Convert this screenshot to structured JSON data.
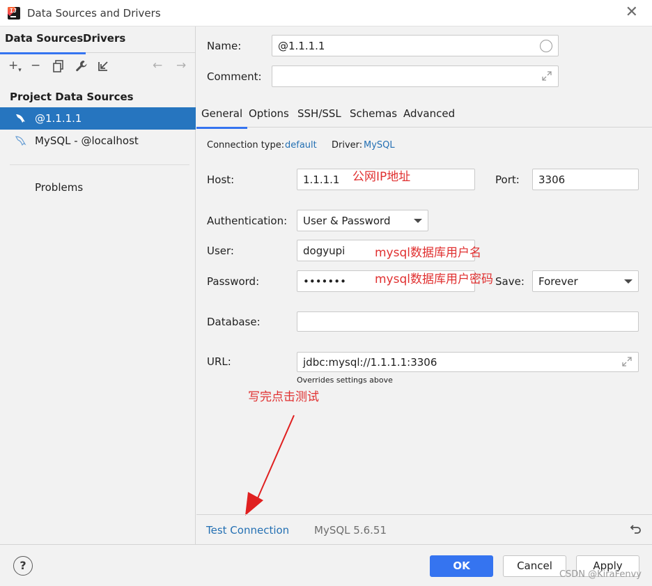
{
  "window": {
    "title": "Data Sources and Drivers"
  },
  "left_panel": {
    "tabs": [
      "Data Sources",
      "Drivers"
    ],
    "section_title": "Project Data Sources",
    "items": [
      {
        "label": "@1.1.1.1",
        "selected": true
      },
      {
        "label": "MySQL - @localhost",
        "selected": false
      }
    ],
    "problems_label": "Problems"
  },
  "form": {
    "name_label": "Name:",
    "name_value": "@1.1.1.1",
    "comment_label": "Comment:",
    "comment_value": "",
    "tabs": [
      "General",
      "Options",
      "SSH/SSL",
      "Schemas",
      "Advanced"
    ],
    "active_tab": "General",
    "connection_type_label": "Connection type:",
    "connection_type_value": "default",
    "driver_label": "Driver:",
    "driver_value": "MySQL",
    "host_label": "Host:",
    "host_value": "1.1.1.1",
    "port_label": "Port:",
    "port_value": "3306",
    "auth_label": "Authentication:",
    "auth_value": "User & Password",
    "user_label": "User:",
    "user_value": "dogyupi",
    "password_label": "Password:",
    "password_value": "•••••••",
    "save_label": "Save:",
    "save_value": "Forever",
    "database_label": "Database:",
    "database_value": "",
    "url_label": "URL:",
    "url_value": "jdbc:mysql://1.1.1.1:3306",
    "url_hint": "Overrides settings above"
  },
  "annotations": {
    "host_note": "公网IP地址",
    "user_note": "mysql数据库用户名",
    "password_note": "mysql数据库用户密码",
    "test_note": "写完点击测试"
  },
  "bottom": {
    "test_connection": "Test Connection",
    "mysql_version": "MySQL 5.6.51"
  },
  "footer": {
    "help": "?",
    "ok": "OK",
    "cancel": "Cancel",
    "apply": "Apply",
    "watermark": "CSDN @KiraFenvy"
  },
  "colors": {
    "accent": "#3574f0",
    "selection": "#2675bf",
    "annotation": "#e03030",
    "link": "#2470b3"
  }
}
